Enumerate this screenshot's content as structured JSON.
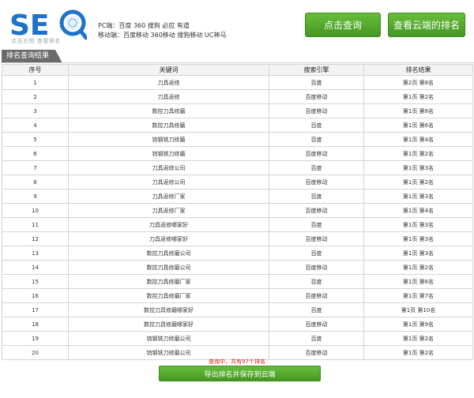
{
  "brand": {
    "logo_text": "SEO",
    "subtitle": "点击右侧 查看排名"
  },
  "engines": {
    "pc": "PC端：百度 360 搜狗 必应 有道",
    "mobile": "移动端：百度移动 360移动 搜狗移动 UC神马"
  },
  "buttons": {
    "query": "点击查询",
    "cloud": "查看云端的排名",
    "export": "导出排名并保存到云端"
  },
  "tab": {
    "label": "排名查询结果"
  },
  "table": {
    "headers": [
      "序号",
      "关键词",
      "搜索引擎",
      "排名结果"
    ],
    "rows": [
      [
        "1",
        "刀具返修",
        "百度",
        "第2页 第8名"
      ],
      [
        "2",
        "刀具返修",
        "百度移动",
        "第1页 第2名"
      ],
      [
        "3",
        "数控刀具修磨",
        "百度移动",
        "第1页 第8名"
      ],
      [
        "4",
        "数控刀具修磨",
        "百度",
        "第1页 第6名"
      ],
      [
        "5",
        "钨钢铣刀修磨",
        "百度",
        "第1页 第4名"
      ],
      [
        "6",
        "钨钢铣刀修磨",
        "百度移动",
        "第1页 第2名"
      ],
      [
        "7",
        "刀具返修公司",
        "百度",
        "第1页 第3名"
      ],
      [
        "8",
        "刀具返修公司",
        "百度移动",
        "第1页 第2名"
      ],
      [
        "9",
        "刀具返修厂家",
        "百度",
        "第1页 第3名"
      ],
      [
        "10",
        "刀具返修厂家",
        "百度移动",
        "第1页 第4名"
      ],
      [
        "11",
        "刀具返修哪家好",
        "百度",
        "第1页 第3名"
      ],
      [
        "12",
        "刀具返修哪家好",
        "百度移动",
        "第1页 第3名"
      ],
      [
        "13",
        "数控刀具修磨公司",
        "百度",
        "第1页 第3名"
      ],
      [
        "14",
        "数控刀具修磨公司",
        "百度移动",
        "第1页 第2名"
      ],
      [
        "15",
        "数控刀具修磨厂家",
        "百度",
        "第1页 第6名"
      ],
      [
        "16",
        "数控刀具修磨厂家",
        "百度移动",
        "第1页 第7名"
      ],
      [
        "17",
        "数控刀具修磨哪家好",
        "百度",
        "第1页 第10名"
      ],
      [
        "18",
        "数控刀具修磨哪家好",
        "百度移动",
        "第1页 第9名"
      ],
      [
        "19",
        "钨钢铣刀修磨公司",
        "百度",
        "第1页 第2名"
      ],
      [
        "20",
        "钨钢铣刀修磨公司",
        "百度移动",
        "第1页 第2名"
      ]
    ]
  },
  "status": "查询中，共有97个排名",
  "colors": {
    "brand_blue": "#1e72c8",
    "button_green": "#4fa629",
    "status_red": "#dd2211"
  }
}
